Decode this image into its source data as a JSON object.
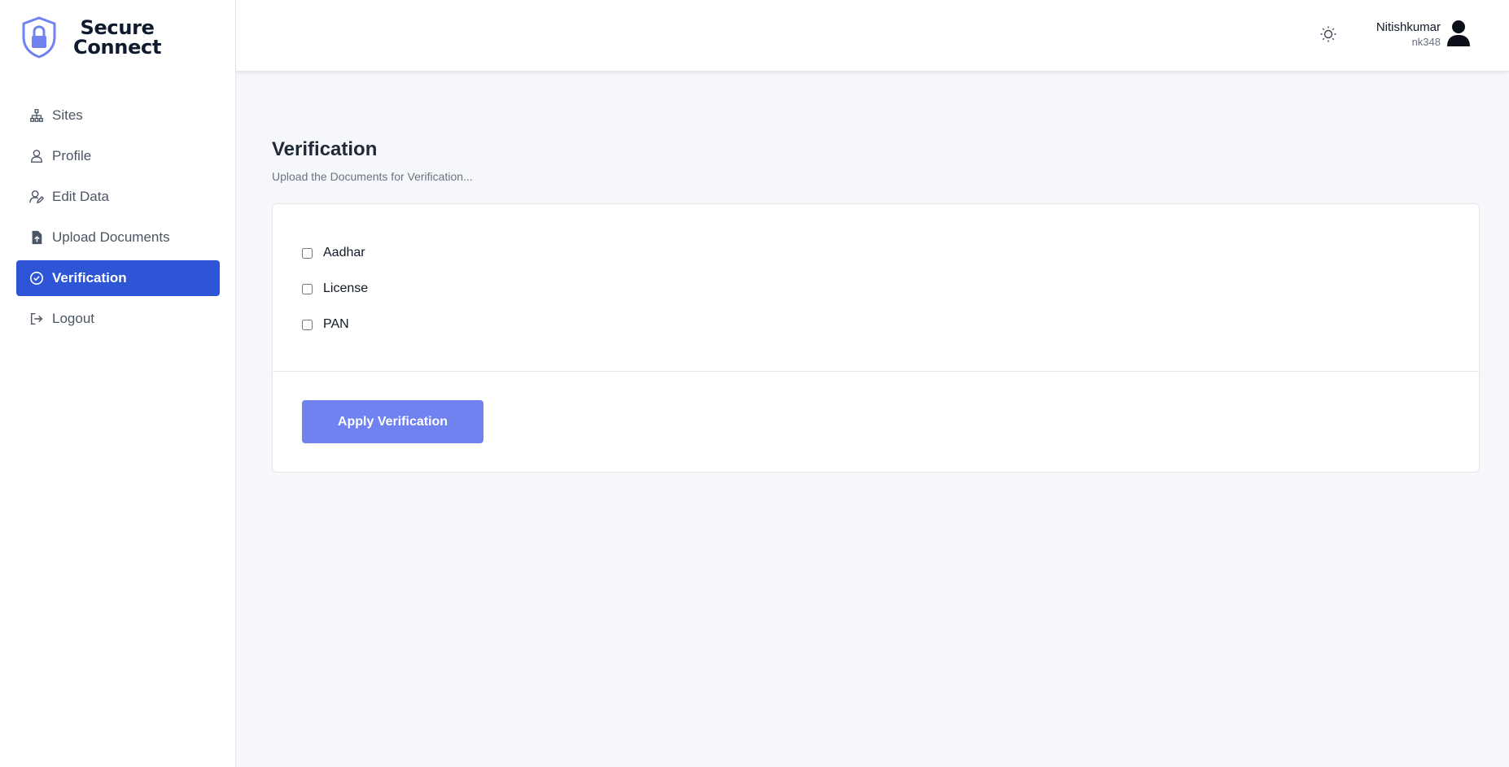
{
  "app": {
    "name_line1": "Secure",
    "name_line2": "Connect"
  },
  "sidebar": {
    "items": [
      {
        "label": "Sites",
        "icon": "sitemap-icon"
      },
      {
        "label": "Profile",
        "icon": "user-icon"
      },
      {
        "label": "Edit Data",
        "icon": "user-edit-icon"
      },
      {
        "label": "Upload Documents",
        "icon": "file-upload-icon"
      },
      {
        "label": "Verification",
        "icon": "check-circle-icon",
        "active": true
      },
      {
        "label": "Logout",
        "icon": "logout-icon"
      }
    ]
  },
  "header": {
    "user_name": "Nitishkumar",
    "user_id": "nk348",
    "theme_icon": "sun-icon",
    "avatar_icon": "user-avatar-icon"
  },
  "main": {
    "title": "Verification",
    "subtitle": "Upload the Documents for Verification...",
    "options": [
      {
        "label": "Aadhar",
        "checked": false
      },
      {
        "label": "License",
        "checked": false
      },
      {
        "label": "PAN",
        "checked": false
      }
    ],
    "apply_label": "Apply Verification"
  },
  "colors": {
    "accent": "#2d55d6",
    "button": "#6f82f0",
    "background": "#f5f7fb"
  }
}
